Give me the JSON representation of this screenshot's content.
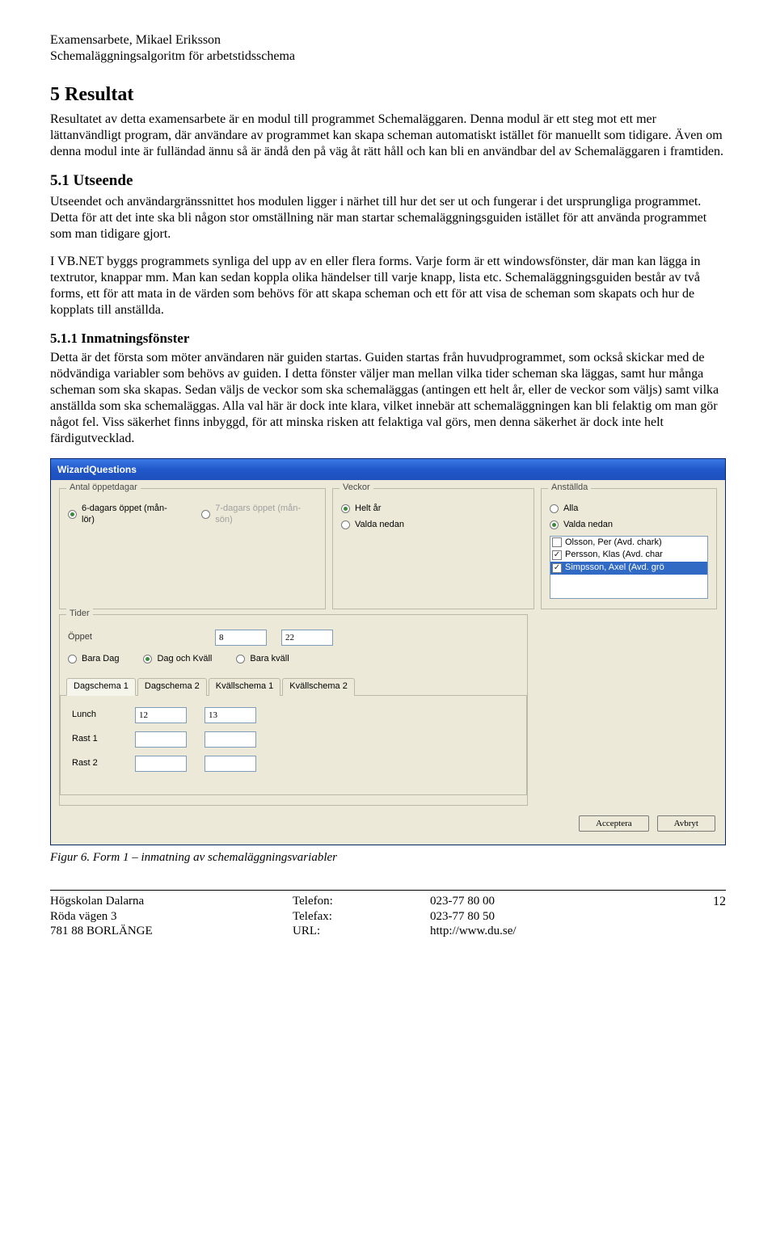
{
  "header": {
    "line1": "Examensarbete, Mikael Eriksson",
    "line2": "Schemaläggningsalgoritm för arbetstidsschema"
  },
  "h1": "5 Resultat",
  "p1": "Resultatet av detta examensarbete är en modul till programmet Schemaläggaren. Denna modul är ett steg mot ett mer lättanvändligt program, där användare av programmet kan skapa scheman automatiskt istället för manuellt som tidigare. Även om denna modul inte är fulländad ännu så är ändå den på väg åt rätt håll och kan bli en användbar del av Schemaläggaren i framtiden.",
  "h2": "5.1 Utseende",
  "p2": "Utseendet och användargränssnittet hos modulen ligger i närhet till hur det ser ut och fungerar i det ursprungliga programmet. Detta för att det inte ska bli någon stor omställning när man startar schemaläggningsguiden istället för att använda programmet som man tidigare gjort.",
  "p3": "I VB.NET byggs programmets synliga del upp av en eller flera forms. Varje form är ett windowsfönster, där man kan lägga in textrutor, knappar mm. Man kan sedan koppla olika händelser till varje knapp, lista etc. Schemaläggningsguiden består av två forms, ett för att mata in de värden som behövs för att skapa scheman och ett för att visa de scheman som skapats och hur de kopplats till anställda.",
  "h3": "5.1.1 Inmatningsfönster",
  "p4": "Detta är det första som möter användaren när guiden startas. Guiden startas från huvudprogrammet, som också skickar med de nödvändiga variabler som behövs av guiden. I detta fönster väljer man mellan vilka tider scheman ska läggas, samt hur många scheman som ska skapas. Sedan väljs de veckor som ska schemaläggas (antingen ett helt år, eller de veckor som väljs) samt vilka anställda som ska schemaläggas. Alla val här är dock inte klara, vilket innebär att schemaläggningen kan bli felaktig om man gör något fel. Viss säkerhet finns inbyggd, för att minska risken att felaktiga val görs, men denna säkerhet är dock inte helt färdigutvecklad.",
  "window": {
    "title": "WizardQuestions",
    "groups": {
      "days": {
        "legend": "Antal öppetdagar",
        "opt6": "6-dagars öppet (mån-lör)",
        "opt7": "7-dagars öppet (mån-sön)"
      },
      "weeks": {
        "legend": "Veckor",
        "full": "Helt år",
        "chosen": "Valda nedan"
      },
      "emp": {
        "legend": "Anställda",
        "all": "Alla",
        "chosen": "Valda nedan",
        "items": {
          "a": "Olsson, Per (Avd. chark)",
          "b": "Persson, Klas (Avd. char",
          "c": "Simpsson, Axel (Avd. grö"
        }
      },
      "tider": {
        "legend": "Tider",
        "open": "Öppet",
        "open_from": "8",
        "open_to": "22",
        "r_dag": "Bara Dag",
        "r_dagkvall": "Dag och Kväll",
        "r_kvall": "Bara kväll",
        "tabs": {
          "t1": "Dagschema 1",
          "t2": "Dagschema 2",
          "t3": "Kvällschema 1",
          "t4": "Kvällschema 2"
        },
        "lunch": "Lunch",
        "lunch_from": "12",
        "lunch_to": "13",
        "rast1": "Rast 1",
        "rast2": "Rast 2"
      }
    },
    "buttons": {
      "accept": "Acceptera",
      "cancel": "Avbryt"
    }
  },
  "caption": "Figur 6. Form 1 – inmatning av schemaläggningsvariabler",
  "footer": {
    "c1a": "Högskolan Dalarna",
    "c1b": "Röda vägen 3",
    "c1c": "781 88  BORLÄNGE",
    "c2a": "Telefon:",
    "c2b": "Telefax:",
    "c2c": "URL:",
    "c3a": "023-77 80 00",
    "c3b": "023-77 80 50",
    "c3c": "http://www.du.se/",
    "page": "12"
  }
}
